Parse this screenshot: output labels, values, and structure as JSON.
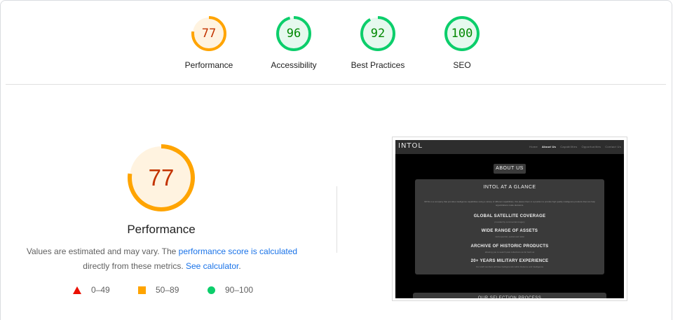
{
  "scores": [
    {
      "label": "Performance",
      "value": "77",
      "score": 77,
      "color": "#ffa400",
      "text_color": "#c33300",
      "bg": "#fff3e0"
    },
    {
      "label": "Accessibility",
      "value": "96",
      "score": 96,
      "color": "#0cce6b",
      "text_color": "#008800",
      "bg": "#e6f9ee"
    },
    {
      "label": "Best Practices",
      "value": "92",
      "score": 92,
      "color": "#0cce6b",
      "text_color": "#008800",
      "bg": "#e6f9ee"
    },
    {
      "label": "SEO",
      "value": "100",
      "score": 100,
      "color": "#0cce6b",
      "text_color": "#008800",
      "bg": "#e6f9ee"
    }
  ],
  "main": {
    "title": "Performance",
    "value": "77",
    "score": 77,
    "desc_text1": "Values are estimated and may vary. The ",
    "desc_link1": "performance score is calculated",
    "desc_text2": " directly from these metrics. ",
    "desc_link2": "See calculator",
    "desc_text3": "."
  },
  "legend": {
    "fail": "0–49",
    "average": "50–89",
    "pass": "90–100"
  },
  "screenshot": {
    "logo": "INTOL",
    "nav": [
      "Home",
      "About Us",
      "Capabilities",
      "Opportunities",
      "Contact Us"
    ],
    "about_button": "ABOUT US",
    "card_heading": "INTOL AT A GLANCE",
    "card_paragraph": "INTOL is a company that provides intelligence capabilities using a variety of different capabilities, this places them in a position to provide high quality intelligence products that can help organizations make decisions.",
    "items": [
      {
        "title": "GLOBAL SATELLITE COVERAGE",
        "text": "provided by commercial imagery"
      },
      {
        "title": "WIDE RANGE OF ASSETS",
        "text": "multi-spectral, optical and radar"
      },
      {
        "title": "ARCHIVE OF HISTORIC PRODUCTS",
        "text": "allowing you to search past collections as far back as"
      },
      {
        "title": "20+ YEARS MILITARY EXPERIENCE",
        "text": "Our staff members all have backgrounds within Defence and Intelligence"
      }
    ],
    "next_section": "OUR SELECTION PROCESS"
  }
}
